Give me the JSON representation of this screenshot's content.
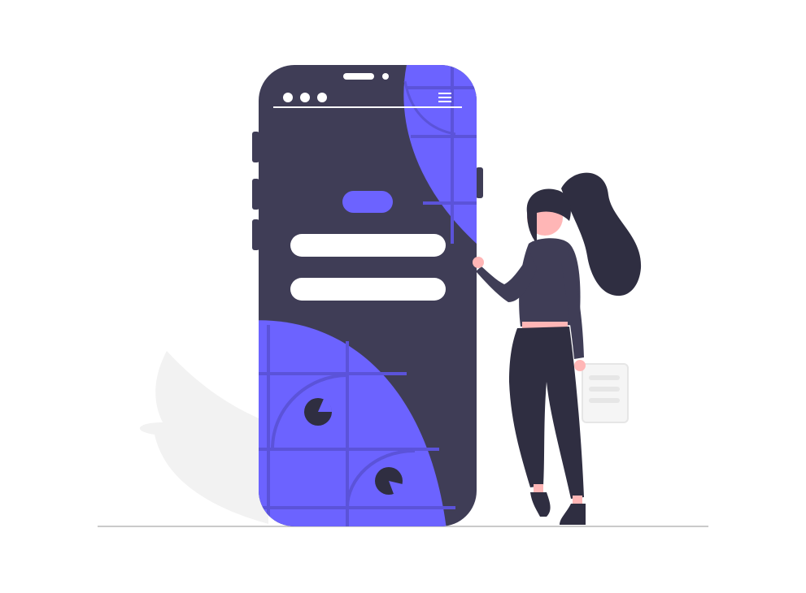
{
  "colors": {
    "background": "#ffffff",
    "phone_body": "#3f3d56",
    "accent": "#6c63ff",
    "accent_line": "#5b53d9",
    "dark": "#2f2e41",
    "light_white": "#ffffff",
    "skin": "#ffb6b6",
    "leaf": "#f2f2f2",
    "card_bg": "#f5f5f5",
    "card_line": "#e6e6e6",
    "ground": "#cacaca"
  },
  "icons": {
    "phone_status": "three-dots-icon",
    "phone_menu": "hamburger-menu-icon",
    "phone_camera": "camera-dot-icon"
  }
}
